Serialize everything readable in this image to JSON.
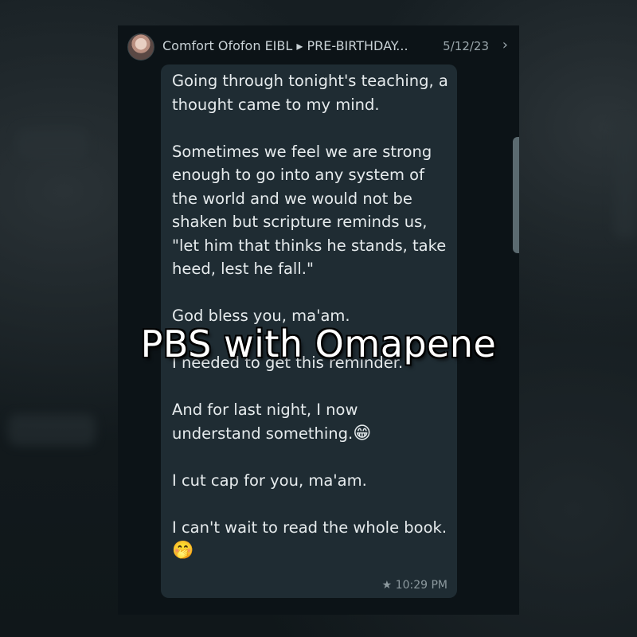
{
  "header": {
    "sender": "Comfort Ofofon EIBL ▸ PRE-BIRTHDAY...",
    "date": "5/12/23",
    "chevron": "›"
  },
  "message": {
    "paragraphs": [
      "Going through tonight's teaching, a thought came to my mind.",
      "Sometimes we feel we are strong enough to go into any system of the world and we would not be shaken but scripture reminds us, \"let him that thinks he stands, take heed, lest he fall.\"",
      "God bless you, ma'am.",
      "I needed to get this reminder.",
      "And for last night, I now understand something.",
      "I cut cap for you, ma'am.",
      "I can't wait to read the whole book."
    ],
    "emoji_grin": "😁",
    "emoji_hand_over_mouth": "🤭",
    "star": "★",
    "time": "10:29 PM"
  },
  "overlay_text": "PBS with Omapene",
  "icons": [
    "avatar",
    "chevron-right-icon",
    "star-icon",
    "grin-emoji",
    "hand-over-mouth-emoji"
  ],
  "colors": {
    "bubble": "#1f2c33",
    "background": "#0c1317",
    "text": "#e6ebed",
    "meta": "#8d9a9f"
  }
}
